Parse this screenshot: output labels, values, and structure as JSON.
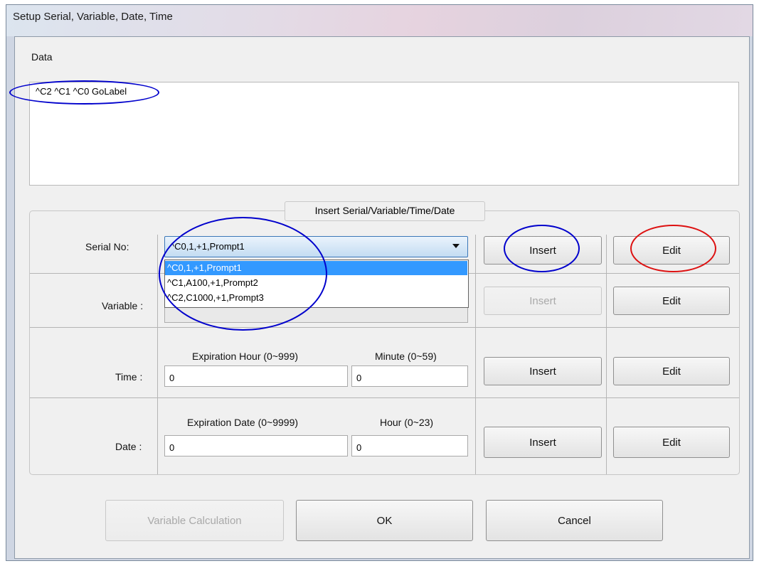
{
  "window": {
    "title": "Setup Serial, Variable, Date, Time"
  },
  "data_section": {
    "label": "Data",
    "content": "^C2 ^C1 ^C0 GoLabel"
  },
  "insert_group": {
    "legend": "Insert Serial/Variable/Time/Date"
  },
  "serial": {
    "label": "Serial No:",
    "selected": "^C0,1,+1,Prompt1",
    "options": [
      "^C0,1,+1,Prompt1",
      "^C1,A100,+1,Prompt2",
      "^C2,C1000,+1,Prompt3"
    ],
    "insert_label": "Insert",
    "edit_label": "Edit"
  },
  "variable": {
    "label": "Variable :",
    "insert_label": "Insert",
    "edit_label": "Edit"
  },
  "time": {
    "label": "Time :",
    "field1_label": "Expiration Hour (0~999)",
    "field1_value": "0",
    "field2_label": "Minute (0~59)",
    "field2_value": "0",
    "insert_label": "Insert",
    "edit_label": "Edit"
  },
  "date": {
    "label": "Date :",
    "field1_label": "Expiration Date (0~9999)",
    "field1_value": "0",
    "field2_label": "Hour (0~23)",
    "field2_value": "0",
    "insert_label": "Insert",
    "edit_label": "Edit"
  },
  "footer": {
    "variable_calc_label": "Variable Calculation",
    "ok_label": "OK",
    "cancel_label": "Cancel"
  },
  "annotation_colors": {
    "blue": "#0000cc",
    "red": "#dd1111"
  }
}
